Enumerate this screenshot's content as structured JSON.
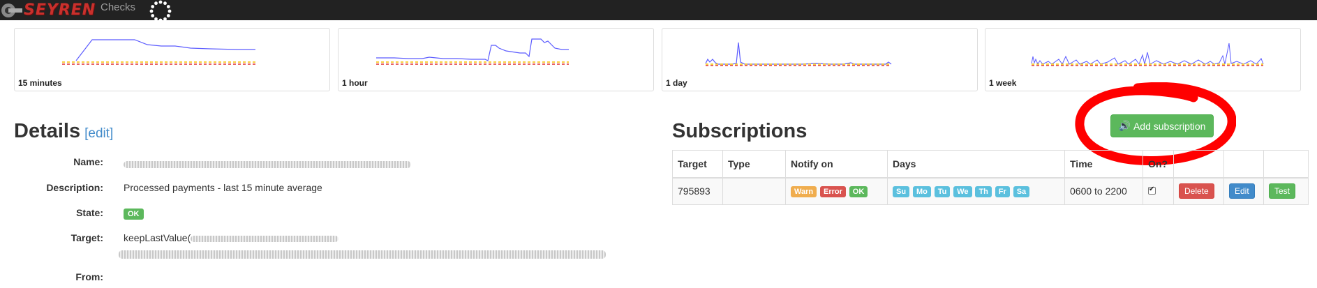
{
  "navbar": {
    "brand": "SEYREN",
    "checks_link": "Checks"
  },
  "graphs": [
    {
      "label": "15 minutes"
    },
    {
      "label": "1 hour"
    },
    {
      "label": "1 day"
    },
    {
      "label": "1 week"
    }
  ],
  "details": {
    "title": "Details",
    "edit_link": "[edit]",
    "name_label": "Name:",
    "description_label": "Description:",
    "description_value": "Processed payments - last 15 minute average",
    "state_label": "State:",
    "state_value": "OK",
    "target_label": "Target:",
    "target_value": "keepLastValue(",
    "from_label": "From:"
  },
  "subscriptions": {
    "title": "Subscriptions",
    "add_button": "Add subscription",
    "columns": [
      "Target",
      "Type",
      "Notify on",
      "Days",
      "Time",
      "On?",
      "",
      "",
      ""
    ],
    "rows": [
      {
        "target": "795893",
        "type": "",
        "notify": {
          "warn": "Warn",
          "error": "Error",
          "ok": "OK"
        },
        "days": [
          "Su",
          "Mo",
          "Tu",
          "We",
          "Th",
          "Fr",
          "Sa"
        ],
        "time": "0600 to 2200",
        "enabled": true,
        "delete": "Delete",
        "edit": "Edit",
        "test": "Test"
      }
    ]
  },
  "colors": {
    "navbar": "#222222",
    "brand": "#c9302c",
    "success": "#5cb85c",
    "danger": "#d9534f",
    "warning": "#f0ad4e",
    "info": "#5bc0de",
    "primary": "#428bca",
    "annotation": "#ff0000"
  }
}
